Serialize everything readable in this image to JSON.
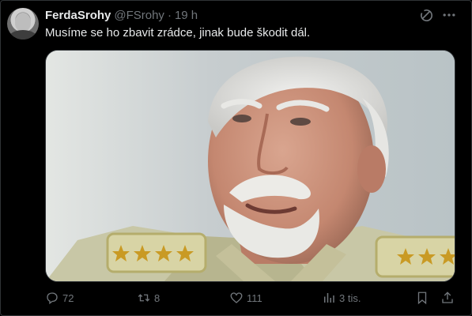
{
  "tweet": {
    "author_name": "FerdaSrohy",
    "handle": "@FSrohy",
    "separator": "·",
    "time": "19 h",
    "text": "Musíme se ho zbavit zrádce, jinak bude škodit dál.",
    "image": {
      "description_icon": "photo-military-officer"
    },
    "actions": {
      "reply_count": "72",
      "retweet_count": "8",
      "like_count": "111",
      "views_count": "3 tis."
    }
  },
  "colors": {
    "background": "#000000",
    "text": "#e7e9ea",
    "muted": "#71767b",
    "border": "#2f3336"
  },
  "icons": [
    "grok-icon",
    "more-icon",
    "reply-icon",
    "retweet-icon",
    "like-icon",
    "views-icon",
    "bookmark-icon",
    "share-icon"
  ]
}
